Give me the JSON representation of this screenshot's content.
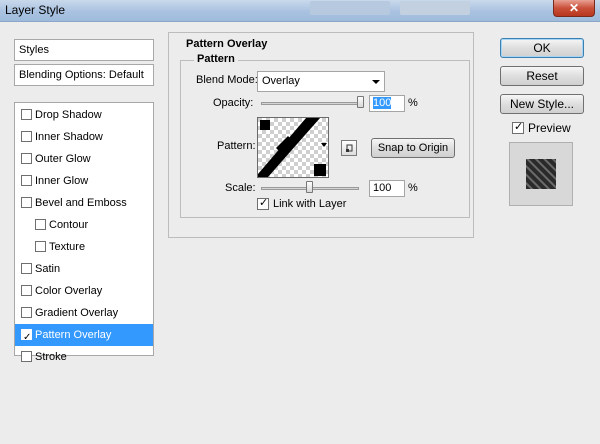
{
  "window": {
    "title": "Layer Style",
    "close_glyph": "✕"
  },
  "left_panel": {
    "styles_label": "Styles",
    "blending_label": "Blending Options: Default",
    "items": [
      {
        "label": "Drop Shadow",
        "checked": false,
        "indent": false,
        "selected": false
      },
      {
        "label": "Inner Shadow",
        "checked": false,
        "indent": false,
        "selected": false
      },
      {
        "label": "Outer Glow",
        "checked": false,
        "indent": false,
        "selected": false
      },
      {
        "label": "Inner Glow",
        "checked": false,
        "indent": false,
        "selected": false
      },
      {
        "label": "Bevel and Emboss",
        "checked": false,
        "indent": false,
        "selected": false
      },
      {
        "label": "Contour",
        "checked": false,
        "indent": true,
        "selected": false
      },
      {
        "label": "Texture",
        "checked": false,
        "indent": true,
        "selected": false
      },
      {
        "label": "Satin",
        "checked": false,
        "indent": false,
        "selected": false
      },
      {
        "label": "Color Overlay",
        "checked": false,
        "indent": false,
        "selected": false
      },
      {
        "label": "Gradient Overlay",
        "checked": false,
        "indent": false,
        "selected": false
      },
      {
        "label": "Pattern Overlay",
        "checked": true,
        "indent": false,
        "selected": true
      },
      {
        "label": "Stroke",
        "checked": false,
        "indent": false,
        "selected": false
      }
    ]
  },
  "pattern_overlay": {
    "group_title": "Pattern Overlay",
    "subgroup_title": "Pattern",
    "blend_mode_label": "Blend Mode:",
    "blend_mode_value": "Overlay",
    "opacity_label": "Opacity:",
    "opacity_value": "100",
    "opacity_level": 1.0,
    "pattern_label": "Pattern:",
    "snap_button": "Snap to Origin",
    "scale_label": "Scale:",
    "scale_value": "100",
    "scale_level": 0.5,
    "percent_sign": "%",
    "link_label": "Link with Layer",
    "link_checked": true
  },
  "actions": {
    "ok": "OK",
    "reset": "Reset",
    "new_style": "New Style...",
    "preview_label": "Preview",
    "preview_checked": true
  },
  "colors": {
    "selection": "#3399ff",
    "titlebar": "#a9c2e0",
    "close": "#c9503a"
  }
}
